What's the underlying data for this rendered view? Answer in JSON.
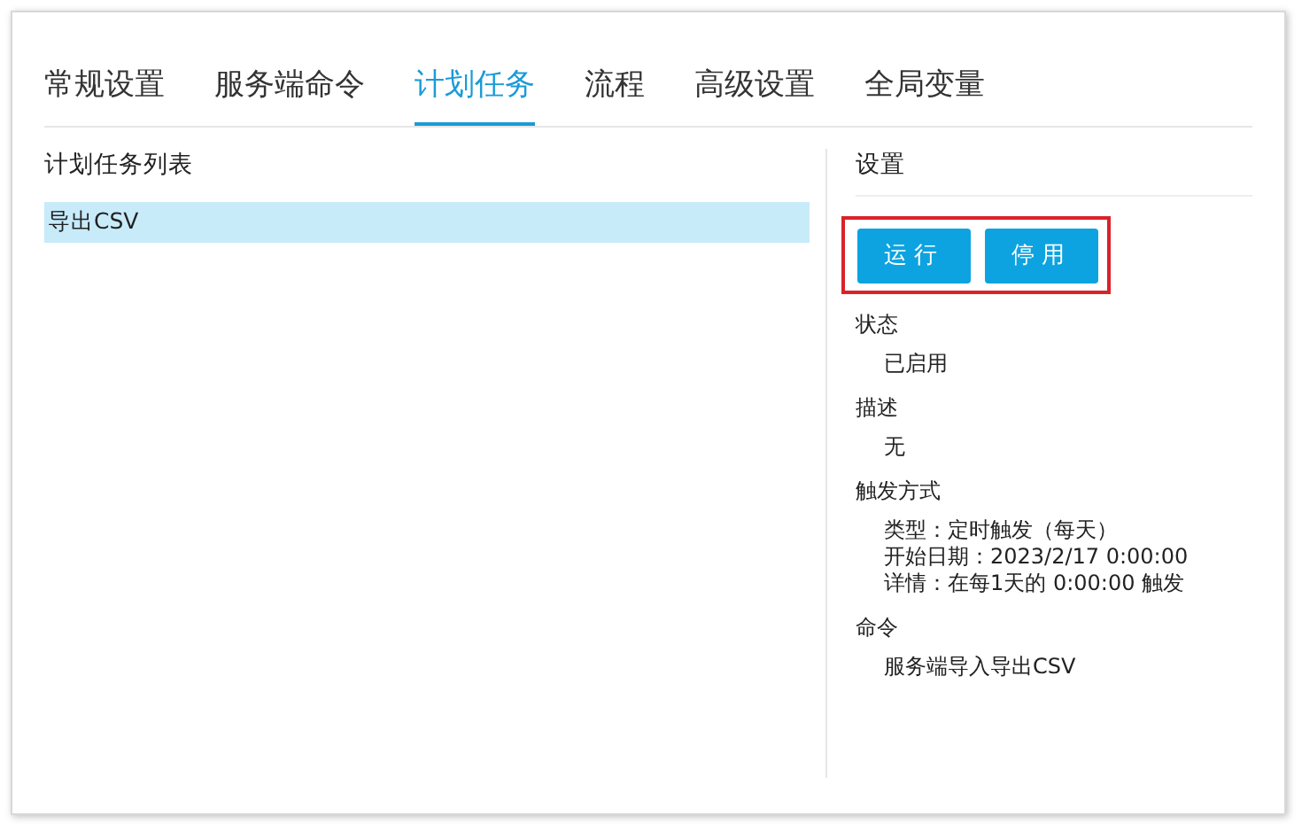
{
  "tabs": [
    {
      "label": "常规设置",
      "selected": false
    },
    {
      "label": "服务端命令",
      "selected": false
    },
    {
      "label": "计划任务",
      "selected": true
    },
    {
      "label": "流程",
      "selected": false
    },
    {
      "label": "高级设置",
      "selected": false
    },
    {
      "label": "全局变量",
      "selected": false
    }
  ],
  "task_list": {
    "title": "计划任务列表",
    "items": [
      {
        "label": "导出CSV",
        "selected": true
      }
    ]
  },
  "settings": {
    "title": "设置",
    "buttons": [
      "运行",
      "停用"
    ],
    "sections": [
      {
        "label": "状态",
        "lines": [
          "已启用"
        ]
      },
      {
        "label": "描述",
        "lines": [
          "无"
        ]
      },
      {
        "label": "触发方式",
        "lines": [
          "类型：定时触发（每天）",
          "开始日期：2023/2/17 0:00:00",
          "详情：在每1天的 0:00:00 触发"
        ]
      },
      {
        "label": "命令",
        "lines": [
          "服务端导入导出CSV"
        ]
      }
    ]
  }
}
